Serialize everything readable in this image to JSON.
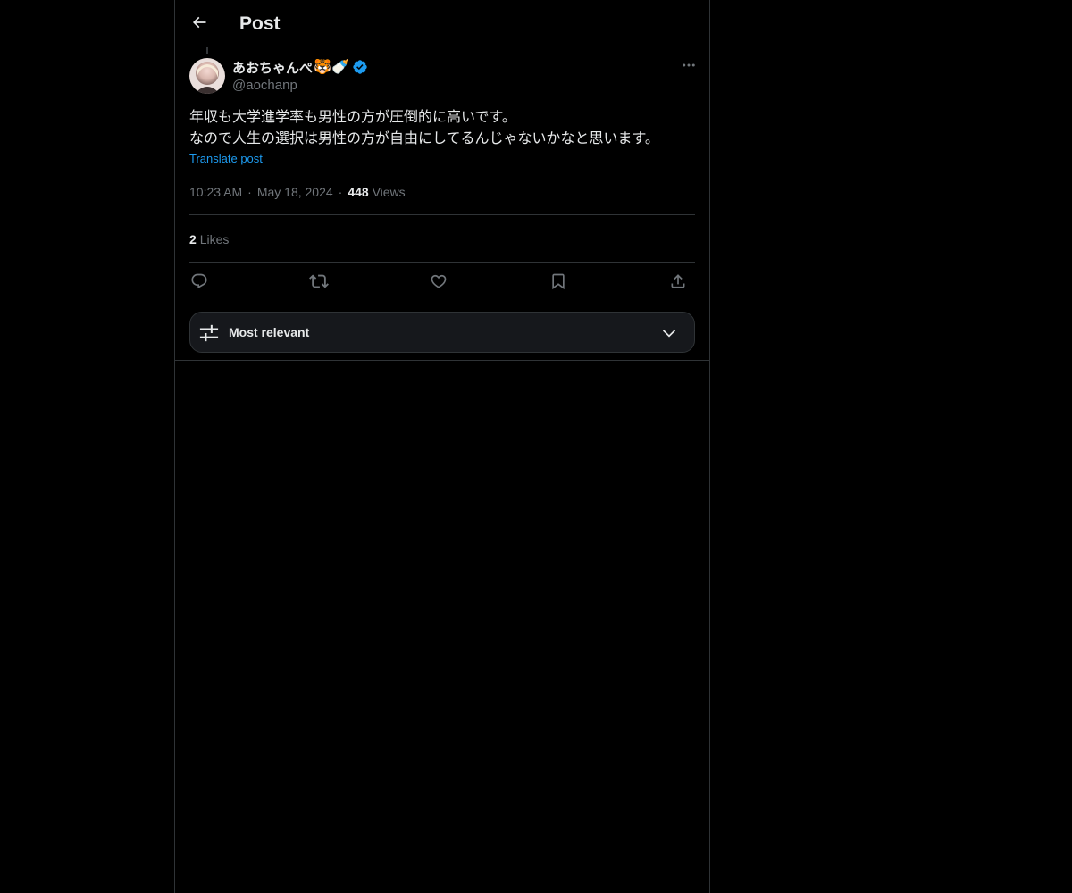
{
  "header": {
    "title": "Post",
    "back_icon": "arrow-left-icon"
  },
  "post": {
    "author": {
      "display_name": "あおちゃんぺ",
      "emojis": "🐯🍼",
      "verified": true,
      "handle": "@aochanp"
    },
    "text_lines": [
      "年収も大学進学率も男性の方が圧倒的に高いです。",
      "なので人生の選択は男性の方が自由にしてるんじゃないかなと思います。"
    ],
    "translate_label": "Translate post",
    "time": "10:23 AM",
    "date": "May 18, 2024",
    "views_count": "448",
    "views_label": "Views",
    "likes_count": "2",
    "likes_label": "Likes"
  },
  "actions": [
    "reply-icon",
    "repost-icon",
    "like-icon",
    "bookmark-icon",
    "share-icon"
  ],
  "sort": {
    "label": "Most relevant",
    "icon": "sliders-icon",
    "chevron": "chevron-down-icon"
  },
  "colors": {
    "background": "#000000",
    "text": "#e7e9ea",
    "muted": "#71767b",
    "accent": "#1d9bf0",
    "border": "#2f3336"
  }
}
